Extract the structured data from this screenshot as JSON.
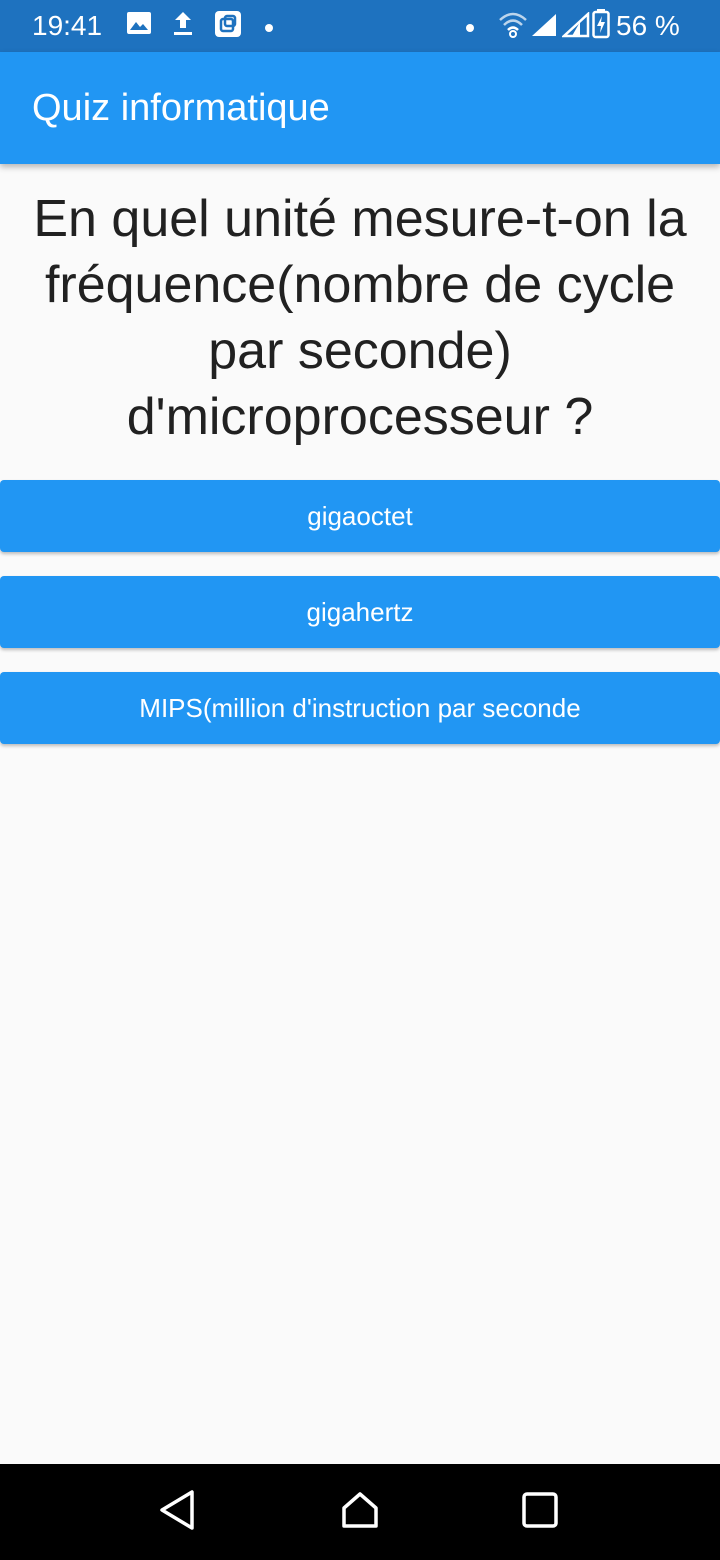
{
  "status_bar": {
    "time": "19:41",
    "battery_percent": "56 %",
    "icons": [
      "image-icon",
      "upload-icon",
      "app-notification-icon",
      "dot-icon",
      "dot-icon",
      "wifi-icon",
      "signal-icon",
      "signal-icon",
      "battery-charging-icon"
    ]
  },
  "app_bar": {
    "title": "Quiz informatique"
  },
  "question": {
    "text": "En quel unité mesure-t-on la fréquence(nombre de cycle par seconde) d'microprocesseur ?"
  },
  "answers": [
    {
      "label": "gigaoctet"
    },
    {
      "label": "gigahertz"
    },
    {
      "label": "MIPS(million d'instruction par seconde"
    }
  ],
  "nav_bar": {
    "icons": [
      "back-icon",
      "home-icon",
      "recents-icon"
    ]
  },
  "colors": {
    "status_bar": "#1e72bf",
    "primary": "#2196f3",
    "background": "#fafafa",
    "text": "#212121"
  }
}
